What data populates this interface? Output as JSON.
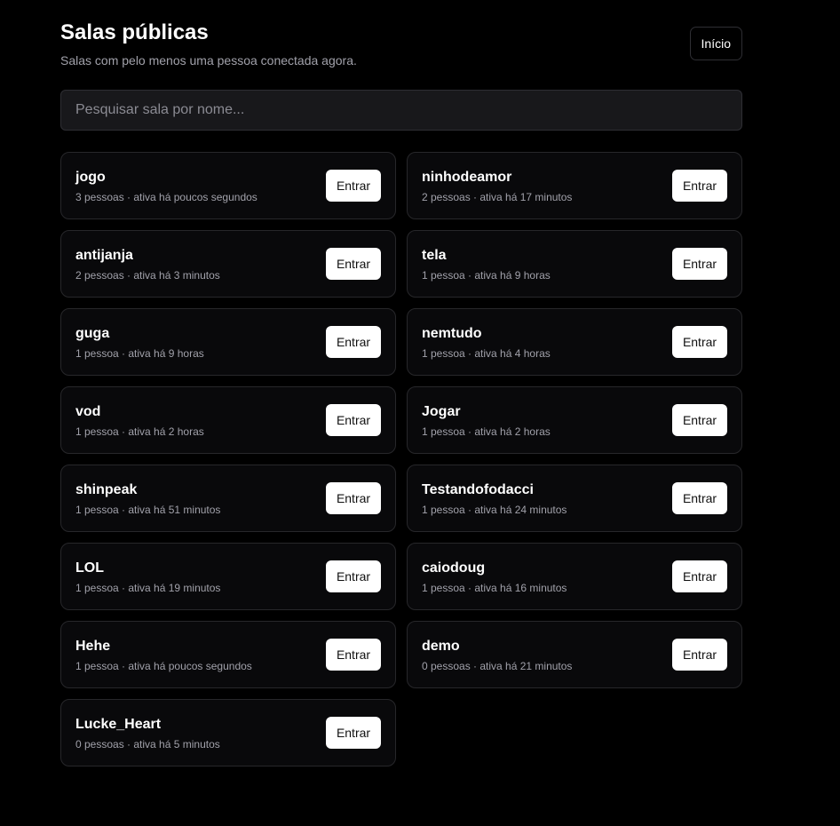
{
  "header": {
    "title": "Salas públicas",
    "subtitle": "Salas com pelo menos uma pessoa conectada agora.",
    "home_label": "Início"
  },
  "search": {
    "placeholder": "Pesquisar sala por nome...",
    "value": ""
  },
  "enter_label": "Entrar",
  "rooms": [
    {
      "name": "jogo",
      "meta": "3 pessoas · ativa há poucos segundos"
    },
    {
      "name": "ninhodeamor",
      "meta": "2 pessoas · ativa há 17 minutos"
    },
    {
      "name": "antijanja",
      "meta": "2 pessoas · ativa há 3 minutos"
    },
    {
      "name": "tela",
      "meta": "1 pessoa · ativa há 9 horas"
    },
    {
      "name": "guga",
      "meta": "1 pessoa · ativa há 9 horas"
    },
    {
      "name": "nemtudo",
      "meta": "1 pessoa · ativa há 4 horas"
    },
    {
      "name": "vod",
      "meta": "1 pessoa · ativa há 2 horas"
    },
    {
      "name": "Jogar",
      "meta": "1 pessoa · ativa há 2 horas"
    },
    {
      "name": "shinpeak",
      "meta": "1 pessoa · ativa há 51 minutos"
    },
    {
      "name": "Testandofodacci",
      "meta": "1 pessoa · ativa há 24 minutos"
    },
    {
      "name": "LOL",
      "meta": "1 pessoa · ativa há 19 minutos"
    },
    {
      "name": "caiodoug",
      "meta": "1 pessoa · ativa há 16 minutos"
    },
    {
      "name": "Hehe",
      "meta": "1 pessoa · ativa há poucos segundos"
    },
    {
      "name": "demo",
      "meta": "0 pessoas · ativa há 21 minutos"
    },
    {
      "name": "Lucke_Heart",
      "meta": "0 pessoas · ativa há 5 minutos"
    }
  ]
}
